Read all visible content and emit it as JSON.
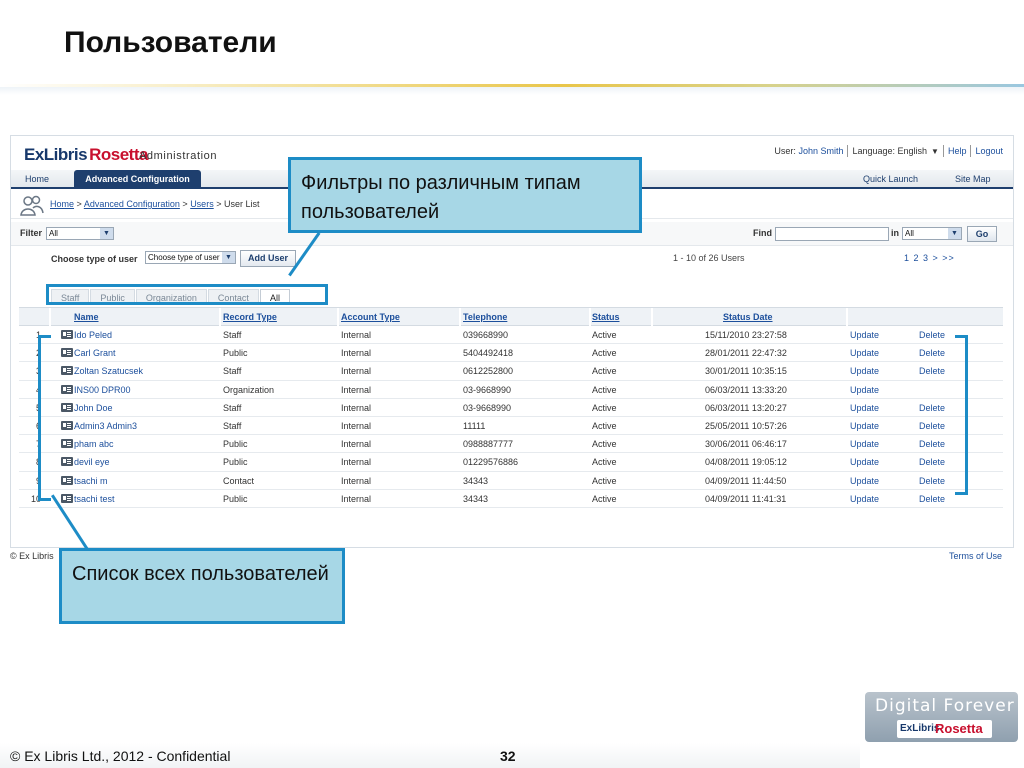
{
  "slide": {
    "title": "Пользователи",
    "footer_text": "© Ex Libris Ltd., 2012  - Confidential",
    "page_number": "32",
    "badge_text": "Digital Forever",
    "badge_logo_ex": "ExLibris",
    "badge_logo_rosetta": "Rosetta"
  },
  "app": {
    "brand_ex": "ExLibris",
    "brand_rosetta": "Rosetta",
    "brand_sub": "Administration",
    "userbar": {
      "user_label": "User:",
      "user_name": "John Smith",
      "language": "Language: English",
      "help": "Help",
      "logout": "Logout"
    },
    "nav": {
      "home": "Home",
      "active": "Advanced Configuration",
      "quick_launch": "Quick Launch",
      "site_map": "Site Map"
    },
    "breadcrumb": {
      "home": "Home",
      "adv": "Advanced Configuration",
      "users": "Users",
      "current": "User List",
      "sep": ">"
    },
    "filter": {
      "label": "Filter",
      "value": "All",
      "find_label": "Find",
      "in_label": "in",
      "in_value": "All",
      "go": "Go"
    },
    "type": {
      "label": "Choose type of user",
      "select_value": "Choose type of user",
      "add_button": "Add User",
      "paging": "1 - 10 of 26 Users",
      "pages": "1 2 3 > >>"
    },
    "tabs": [
      "Staff",
      "Public",
      "Organization",
      "Contact",
      "All"
    ],
    "columns": [
      "Name",
      "Record Type",
      "Account Type",
      "Telephone",
      "Status",
      "Status Date"
    ],
    "rows": [
      {
        "n": "1",
        "name": "Ido Peled",
        "record": "Staff",
        "account": "Internal",
        "tel": "039668990",
        "status": "Active",
        "date": "15/11/2010 23:27:58",
        "update": "Update",
        "delete": "Delete"
      },
      {
        "n": "2",
        "name": "Carl Grant",
        "record": "Public",
        "account": "Internal",
        "tel": "5404492418",
        "status": "Active",
        "date": "28/01/2011 22:47:32",
        "update": "Update",
        "delete": "Delete"
      },
      {
        "n": "3",
        "name": "Zoltan Szatucsek",
        "record": "Staff",
        "account": "Internal",
        "tel": "0612252800",
        "status": "Active",
        "date": "30/01/2011 10:35:15",
        "update": "Update",
        "delete": "Delete"
      },
      {
        "n": "4",
        "name": "INS00 DPR00",
        "record": "Organization",
        "account": "Internal",
        "tel": "03-9668990",
        "status": "Active",
        "date": "06/03/2011 13:33:20",
        "update": "Update",
        "delete": ""
      },
      {
        "n": "5",
        "name": "John Doe",
        "record": "Staff",
        "account": "Internal",
        "tel": "03-9668990",
        "status": "Active",
        "date": "06/03/2011 13:20:27",
        "update": "Update",
        "delete": "Delete"
      },
      {
        "n": "6",
        "name": "Admin3 Admin3",
        "record": "Staff",
        "account": "Internal",
        "tel": "11111",
        "status": "Active",
        "date": "25/05/2011 10:57:26",
        "update": "Update",
        "delete": "Delete"
      },
      {
        "n": "7",
        "name": "pham abc",
        "record": "Public",
        "account": "Internal",
        "tel": "0988887777",
        "status": "Active",
        "date": "30/06/2011 06:46:17",
        "update": "Update",
        "delete": "Delete"
      },
      {
        "n": "8",
        "name": "devil eye",
        "record": "Public",
        "account": "Internal",
        "tel": "01229576886",
        "status": "Active",
        "date": "04/08/2011 19:05:12",
        "update": "Update",
        "delete": "Delete"
      },
      {
        "n": "9",
        "name": "tsachi m",
        "record": "Contact",
        "account": "Internal",
        "tel": "34343",
        "status": "Active",
        "date": "04/09/2011 11:44:50",
        "update": "Update",
        "delete": "Delete"
      },
      {
        "n": "10",
        "name": "tsachi test",
        "record": "Public",
        "account": "Internal",
        "tel": "34343",
        "status": "Active",
        "date": "04/09/2011 11:41:31",
        "update": "Update",
        "delete": "Delete"
      }
    ],
    "footer_left": "© Ex Libris",
    "footer_right": "Terms of Use"
  },
  "callouts": {
    "filters": "Фильтры по различным типам пользователей",
    "list": "Список всех пользователей"
  },
  "colors": {
    "accent": "#1d8cc6",
    "callout_fill": "#a7d7e6",
    "nav": "#1e3f6e",
    "link": "#1c4f9c",
    "brand_red": "#c8102e"
  }
}
